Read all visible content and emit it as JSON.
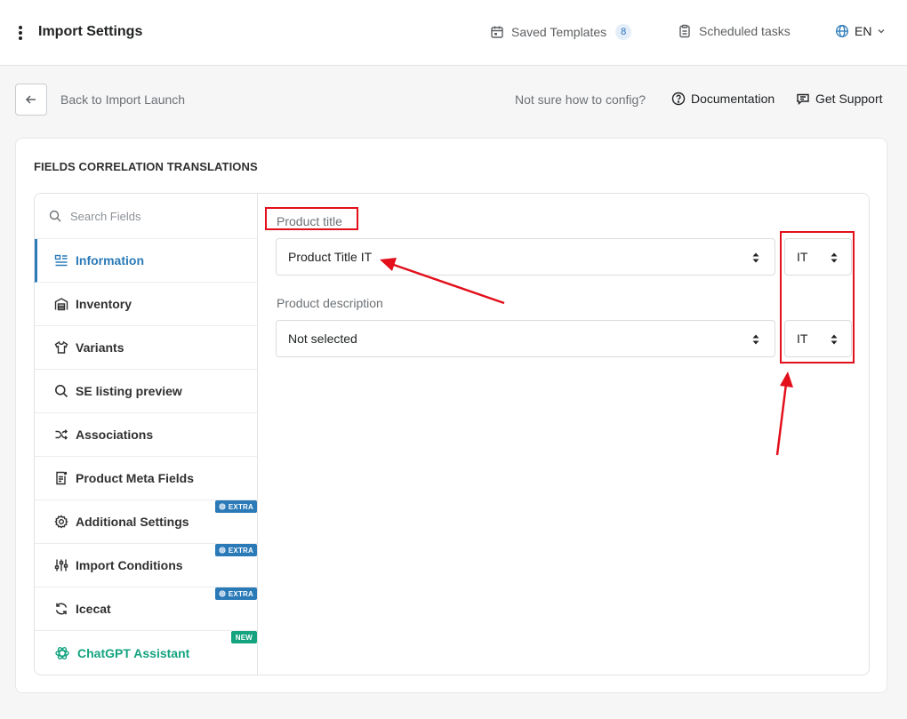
{
  "header": {
    "title": "Import Settings",
    "saved_templates": "Saved Templates",
    "saved_templates_count": "8",
    "scheduled_tasks": "Scheduled tasks",
    "language": "EN"
  },
  "subheader": {
    "back_label": "Back to Import Launch",
    "not_sure": "Not sure how to config?",
    "documentation": "Documentation",
    "support": "Get Support"
  },
  "card": {
    "title": "FIELDS CORRELATION TRANSLATIONS"
  },
  "sidebar": {
    "search_placeholder": "Search Fields",
    "items": [
      {
        "label": "Information",
        "icon": "information-icon",
        "active": true
      },
      {
        "label": "Inventory",
        "icon": "warehouse-icon"
      },
      {
        "label": "Variants",
        "icon": "shirt-icon"
      },
      {
        "label": "SE listing preview",
        "icon": "search-icon"
      },
      {
        "label": "Associations",
        "icon": "shuffle-icon"
      },
      {
        "label": "Product Meta Fields",
        "icon": "document-icon"
      },
      {
        "label": "Additional Settings",
        "icon": "gear-icon",
        "tag": "EXTRA"
      },
      {
        "label": "Import Conditions",
        "icon": "sliders-icon",
        "tag": "EXTRA"
      },
      {
        "label": "Icecat",
        "icon": "refresh-icon",
        "tag": "EXTRA"
      },
      {
        "label": "ChatGPT Assistant",
        "icon": "openai-icon",
        "tag": "NEW"
      }
    ]
  },
  "fields": [
    {
      "label": "Product title",
      "value": "Product Title IT",
      "lang": "IT"
    },
    {
      "label": "Product description",
      "value": "Not selected",
      "lang": "IT"
    }
  ],
  "colors": {
    "accent": "#2b7ab8",
    "gpt_green": "#13a37f",
    "annotation_red": "#e30f1b"
  }
}
